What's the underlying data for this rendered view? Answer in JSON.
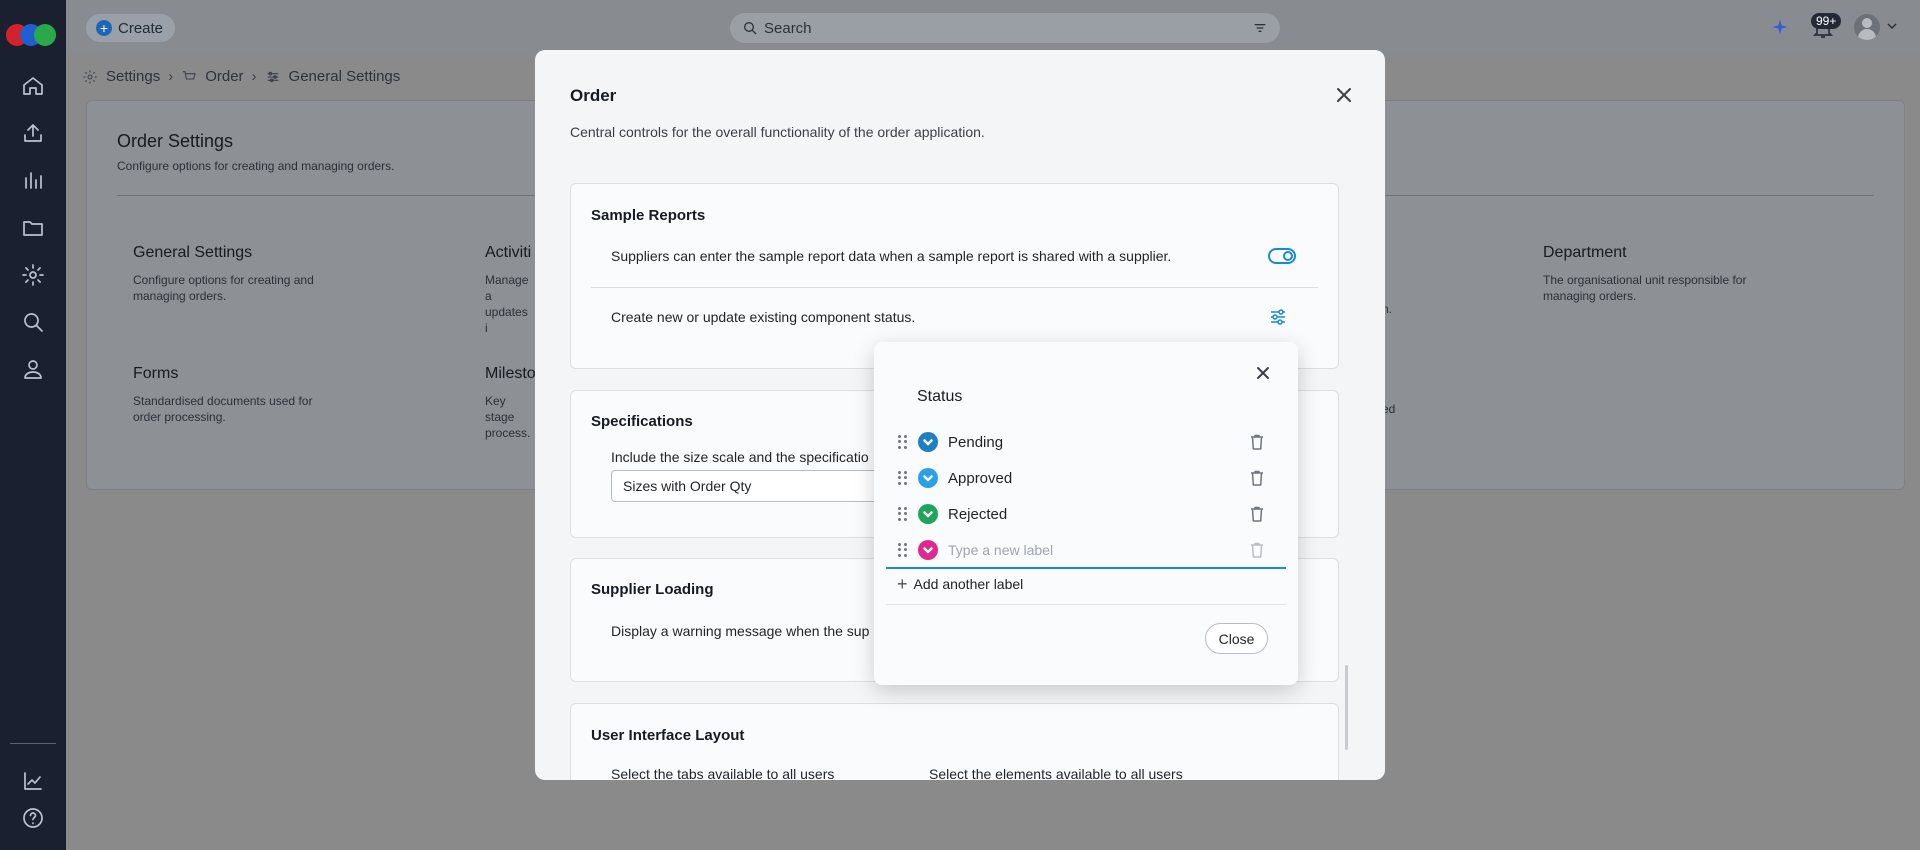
{
  "topbar": {
    "create_label": "Create",
    "search_placeholder": "Search",
    "notification_count": "99+"
  },
  "breadcrumb": [
    "Settings",
    "Order",
    "General Settings"
  ],
  "settings": {
    "title": "Order Settings",
    "subtitle": "Configure options for creating and managing orders.",
    "tiles": [
      {
        "title": "General Settings",
        "desc": "Configure options for creating and managing orders."
      },
      {
        "title": "Activiti",
        "desc": "Manage a updates i"
      },
      {
        "title": "Department",
        "desc": "The organisational unit responsible for managing orders."
      },
      {
        "title": "Forms",
        "desc": "Standardised documents used for order processing."
      },
      {
        "title": "Milesto",
        "desc": "Key stage process."
      }
    ],
    "tile_fragments": [
      "n.",
      "ed"
    ]
  },
  "modal": {
    "title": "Order",
    "description": "Central controls for the overall functionality of the order application.",
    "sections": {
      "sample_reports": {
        "title": "Sample Reports",
        "row1": "Suppliers can enter the sample report data when a sample report is shared with a supplier.",
        "row2": "Create new or update existing component status."
      },
      "specifications": {
        "title": "Specifications",
        "text": "Include the size scale and the specificatio",
        "select_value": "Sizes with Order Qty"
      },
      "supplier_loading": {
        "title": "Supplier Loading",
        "text": "Display a warning message when the sup"
      },
      "ui_layout": {
        "title": "User Interface Layout",
        "col1": "Select the tabs available to all users",
        "col2": "Select the elements available to all users"
      }
    }
  },
  "status_popover": {
    "title": "Status",
    "labels": [
      {
        "label": "Pending",
        "color": "#1e7fc4"
      },
      {
        "label": "Approved",
        "color": "#2aa0e8"
      },
      {
        "label": "Rejected",
        "color": "#1ea55a"
      }
    ],
    "new_label_color": "#e0298f",
    "new_label_placeholder": "Type a new label",
    "add_label": "Add another label",
    "close_label": "Close"
  },
  "colors": {
    "accent": "#1a8ad4",
    "sidebar": "#1b2030"
  }
}
